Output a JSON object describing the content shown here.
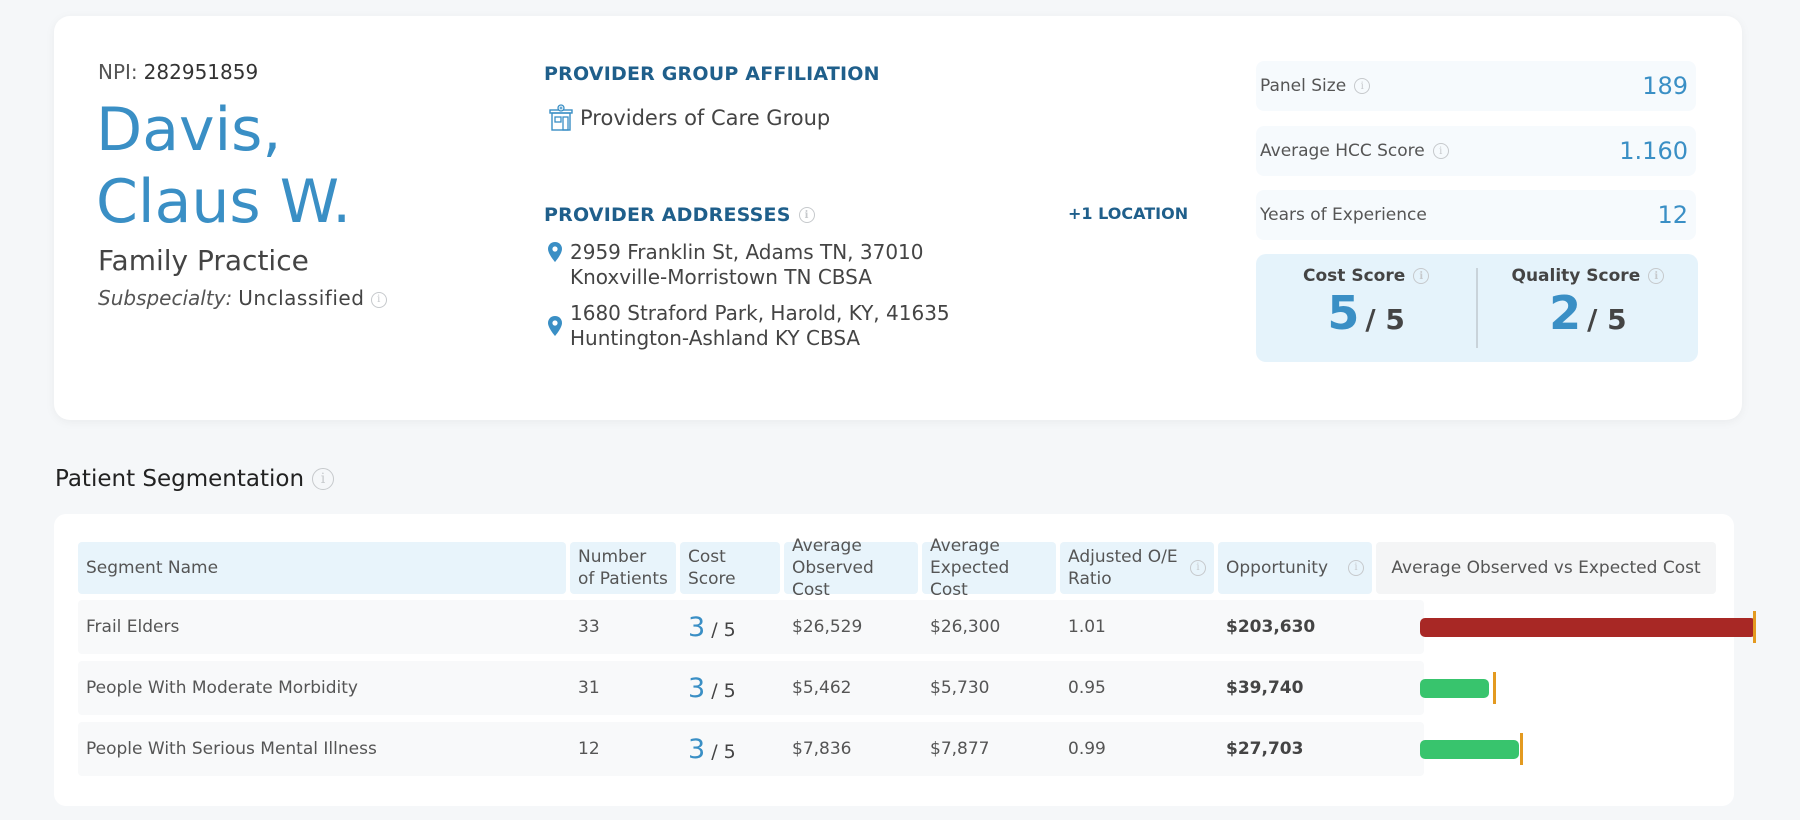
{
  "provider": {
    "npi_label": "NPI:",
    "npi": "282951859",
    "name_line1": "Davis,",
    "name_line2": "Claus W.",
    "specialty": "Family Practice",
    "subspecialty_label": "Subspecialty:",
    "subspecialty": "Unclassified"
  },
  "affiliation": {
    "title": "PROVIDER GROUP  AFFILIATION",
    "group": "Providers of Care Group"
  },
  "addresses": {
    "title": "PROVIDER ADDRESSES",
    "more_link": "+1 LOCATION",
    "items": [
      {
        "line1": "2959 Franklin St, Adams TN, 37010",
        "line2": "Knoxville-Morristown TN CBSA"
      },
      {
        "line1": "1680 Straford Park, Harold, KY, 41635",
        "line2": "Huntington-Ashland KY CBSA"
      }
    ]
  },
  "stats": [
    {
      "label": "Panel Size",
      "value": "189",
      "info": true
    },
    {
      "label": "Average HCC Score",
      "value": "1.160",
      "info": true
    },
    {
      "label": "Years of Experience",
      "value": "12",
      "info": false
    }
  ],
  "scores": {
    "cost": {
      "label": "Cost Score",
      "value": "5",
      "max": "/ 5"
    },
    "quality": {
      "label": "Quality Score",
      "value": "2",
      "max": "/ 5"
    }
  },
  "segmentation": {
    "title": "Patient Segmentation",
    "headers": {
      "segment": "Segment Name",
      "patients": "Number of Patients",
      "cost_score": "Cost Score",
      "observed": "Average Observed Cost",
      "expected": "Average Expected Cost",
      "ratio": "Adjusted O/E Ratio",
      "opportunity": "Opportunity",
      "chart": "Average Observed vs Expected Cost"
    },
    "rows": [
      {
        "segment": "Frail Elders",
        "patients": "33",
        "cost_score": "3",
        "cost_max": "/ 5",
        "observed": "$26,529",
        "expected": "$26,300",
        "ratio": "1.01",
        "opportunity": "$203,630"
      },
      {
        "segment": "People With Moderate Morbidity",
        "patients": "31",
        "cost_score": "3",
        "cost_max": "/ 5",
        "observed": "$5,462",
        "expected": "$5,730",
        "ratio": "0.95",
        "opportunity": "$39,740"
      },
      {
        "segment": "People With Serious Mental Illness",
        "patients": "12",
        "cost_score": "3",
        "cost_max": "/ 5",
        "observed": "$7,836",
        "expected": "$7,877",
        "ratio": "0.99",
        "opportunity": "$27,703"
      }
    ]
  },
  "chart_data": {
    "type": "bar",
    "title": "Average Observed vs Expected Cost",
    "categories": [
      "Frail Elders",
      "People With Moderate Morbidity",
      "People With Serious Mental Illness"
    ],
    "series": [
      {
        "name": "Average Observed Cost",
        "values": [
          26529,
          5462,
          7836
        ]
      },
      {
        "name": "Average Expected Cost (marker)",
        "values": [
          26300,
          5730,
          7877
        ]
      }
    ],
    "xlim": [
      0,
      26529
    ],
    "colors": {
      "over": "#a82825",
      "under": "#38c46d",
      "marker": "#e39a20"
    }
  }
}
